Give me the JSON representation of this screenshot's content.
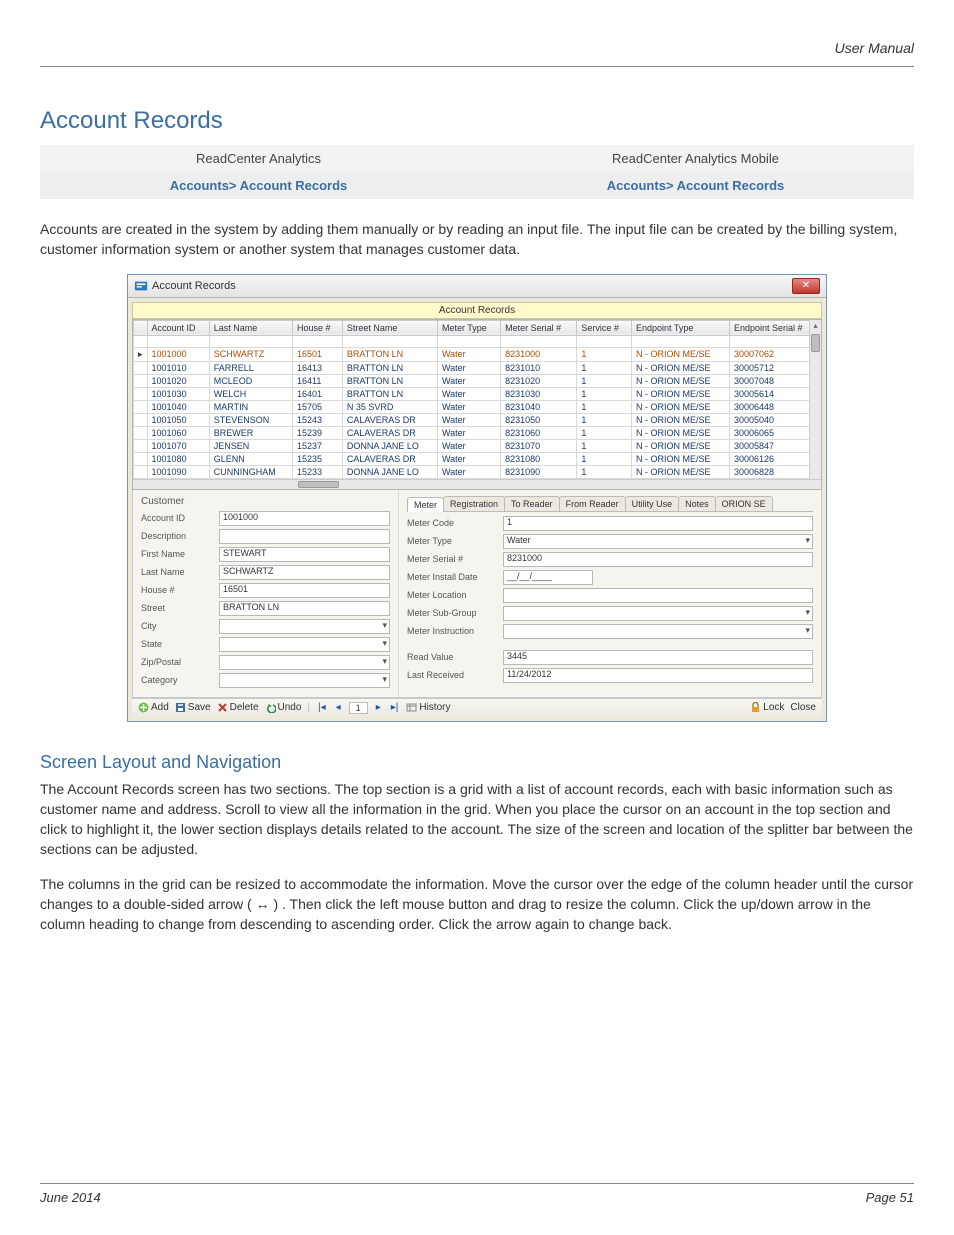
{
  "header_right": "User Manual",
  "page_title": "Account Records",
  "nav": {
    "left_top": "ReadCenter Analytics",
    "right_top": "ReadCenter Analytics Mobile",
    "left_bottom": "Accounts> Account Records",
    "right_bottom": "Accounts> Account Records"
  },
  "intro": "Accounts are created in the system by adding them manually or by reading an input file. The input file can be created by the billing system, customer information system or another system that manages customer data.",
  "screenshot": {
    "window_title": "Account Records",
    "panel_title": "Account Records",
    "columns": [
      "Account ID",
      "Last Name",
      "House #",
      "Street Name",
      "Meter Type",
      "Meter Serial #",
      "Service #",
      "Endpoint Type",
      "Endpoint Serial #"
    ],
    "rows": [
      [
        "1001000",
        "SCHWARTZ",
        "16501",
        "BRATTON LN",
        "Water",
        "8231000",
        "1",
        "N - ORION ME/SE",
        "30007062"
      ],
      [
        "1001010",
        "FARRELL",
        "16413",
        "BRATTON LN",
        "Water",
        "8231010",
        "1",
        "N - ORION ME/SE",
        "30005712"
      ],
      [
        "1001020",
        "MCLEOD",
        "16411",
        "BRATTON LN",
        "Water",
        "8231020",
        "1",
        "N - ORION ME/SE",
        "30007048"
      ],
      [
        "1001030",
        "WELCH",
        "16401",
        "BRATTON LN",
        "Water",
        "8231030",
        "1",
        "N - ORION ME/SE",
        "30005614"
      ],
      [
        "1001040",
        "MARTIN",
        "15705",
        "N 35 SVRD",
        "Water",
        "8231040",
        "1",
        "N - ORION ME/SE",
        "30006448"
      ],
      [
        "1001050",
        "STEVENSON",
        "15243",
        "CALAVERAS DR",
        "Water",
        "8231050",
        "1",
        "N - ORION ME/SE",
        "30005040"
      ],
      [
        "1001060",
        "BREWER",
        "15239",
        "CALAVERAS DR",
        "Water",
        "8231060",
        "1",
        "N - ORION ME/SE",
        "30006065"
      ],
      [
        "1001070",
        "JENSEN",
        "15237",
        "DONNA JANE LO",
        "Water",
        "8231070",
        "1",
        "N - ORION ME/SE",
        "30005847"
      ],
      [
        "1001080",
        "GLENN",
        "15235",
        "CALAVERAS DR",
        "Water",
        "8231080",
        "1",
        "N - ORION ME/SE",
        "30006126"
      ],
      [
        "1001090",
        "CUNNINGHAM",
        "15233",
        "DONNA JANE LO",
        "Water",
        "8231090",
        "1",
        "N - ORION ME/SE",
        "30006828"
      ]
    ],
    "customer_section_label": "Customer",
    "customer_fields": {
      "account_id": {
        "label": "Account ID",
        "value": "1001000"
      },
      "description": {
        "label": "Description",
        "value": ""
      },
      "first_name": {
        "label": "First Name",
        "value": "STEWART"
      },
      "last_name": {
        "label": "Last Name",
        "value": "SCHWARTZ"
      },
      "house": {
        "label": "House #",
        "value": "16501"
      },
      "street": {
        "label": "Street",
        "value": "BRATTON LN"
      },
      "city": {
        "label": "City",
        "value": ""
      },
      "state": {
        "label": "State",
        "value": ""
      },
      "zip": {
        "label": "Zip/Postal",
        "value": ""
      },
      "category": {
        "label": "Category",
        "value": ""
      }
    },
    "tabs": [
      "Meter",
      "Registration",
      "To Reader",
      "From Reader",
      "Utility Use",
      "Notes",
      "ORION SE"
    ],
    "meter_fields": {
      "meter_code": {
        "label": "Meter Code",
        "value": "1"
      },
      "meter_type": {
        "label": "Meter Type",
        "value": "Water"
      },
      "meter_serial": {
        "label": "Meter Serial #",
        "value": "8231000"
      },
      "meter_install": {
        "label": "Meter Install Date",
        "value": "__/__/____"
      },
      "meter_location": {
        "label": "Meter Location",
        "value": ""
      },
      "meter_subgroup": {
        "label": "Meter Sub-Group",
        "value": ""
      },
      "meter_instruction": {
        "label": "Meter Instruction",
        "value": ""
      },
      "read_value": {
        "label": "Read Value",
        "value": "3445"
      },
      "last_received": {
        "label": "Last Received",
        "value": "11/24/2012"
      }
    },
    "toolbar": {
      "add": "Add",
      "save": "Save",
      "delete": "Delete",
      "undo": "Undo",
      "page": "1",
      "history": "History",
      "lock": "Lock",
      "close": "Close"
    }
  },
  "subheading": "Screen Layout and Navigation",
  "para1": "The Account Records screen has two sections. The top section is a grid with a list of account records, each with basic information such as customer name and address. Scroll to view all the information in the grid. When you place the cursor on an account in the top section and click to highlight it, the lower section displays details related to the account. The size of the screen and location of the splitter bar between the sections can be adjusted.",
  "para2": "The columns in the grid can be resized to accommodate the information. Move the cursor over the edge of the column header until the cursor changes to a double-sided arrow ( ↔ ) . Then click the left mouse button and drag to resize the column. Click the up/down arrow in the column heading to change from descending to ascending order. Click the arrow again to change back.",
  "footer": {
    "left": "June 2014",
    "right": "Page 51"
  }
}
